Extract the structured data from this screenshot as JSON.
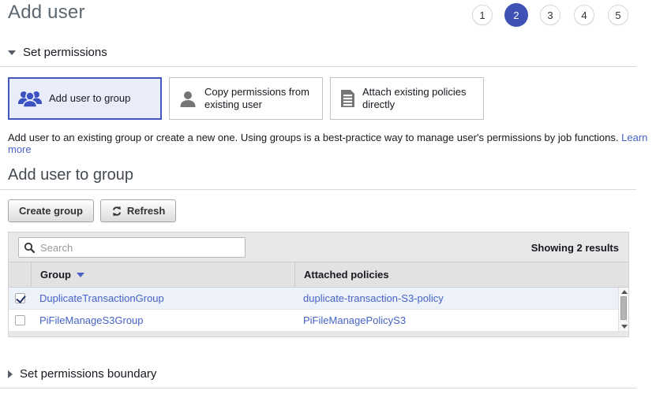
{
  "page_title": "Add user",
  "steps": [
    "1",
    "2",
    "3",
    "4",
    "5"
  ],
  "active_step": "2",
  "sections": {
    "set_permissions": {
      "label": "Set permissions",
      "expanded": true
    },
    "set_permissions_boundary": {
      "label": "Set permissions boundary",
      "expanded": false
    }
  },
  "permission_options": [
    {
      "label": "Add user to group",
      "icon": "group-icon",
      "selected": true
    },
    {
      "label": "Copy permissions from existing user",
      "icon": "user-icon",
      "selected": false
    },
    {
      "label": "Attach existing policies directly",
      "icon": "document-icon",
      "selected": false
    }
  ],
  "description": {
    "text": "Add user to an existing group or create a new one. Using groups is a best-practice way to manage user's permissions by job functions. ",
    "link_label": "Learn more"
  },
  "group_section": {
    "heading": "Add user to group",
    "create_group_label": "Create group",
    "refresh_label": "Refresh",
    "search_placeholder": "Search",
    "search_value": "",
    "results_text": "Showing 2 results",
    "columns": [
      "Group",
      "Attached policies"
    ],
    "sort": {
      "column": "Group",
      "direction": "desc"
    },
    "rows": [
      {
        "checked": true,
        "group": "DuplicateTransactionGroup",
        "policy": "duplicate-transaction-S3-policy"
      },
      {
        "checked": false,
        "group": "PiFileManageS3Group",
        "policy": "PiFileManagePolicyS3"
      }
    ]
  },
  "icons": {
    "search": "magnifier-glyph",
    "refresh": "circular-arrows-glyph",
    "sort": "triangle-down-glyph",
    "collapse_open": "triangle-down-glyph",
    "collapse_closed": "triangle-right-glyph"
  },
  "colors": {
    "accent_blue": "#3f51b5",
    "card_selected_border": "#4456bd",
    "card_selected_bg": "#e9edfa",
    "link_blue": "#4663c6",
    "selected_row_bg": "#edf1fa",
    "panel_bg": "#e8e8e8"
  }
}
